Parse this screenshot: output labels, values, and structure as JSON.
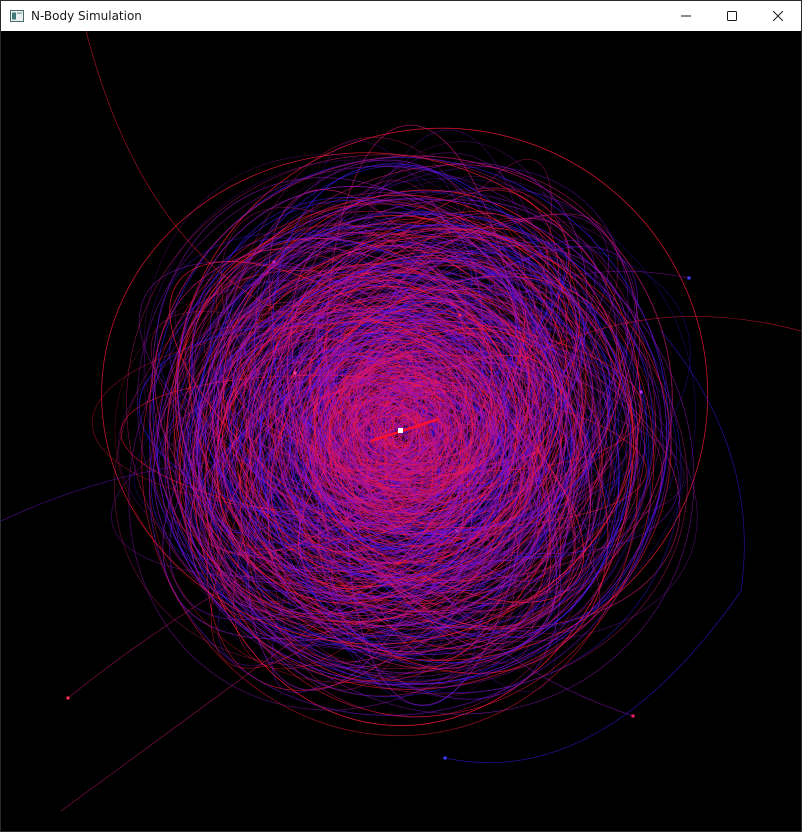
{
  "window": {
    "title": "N-Body Simulation",
    "app_icon": "window-app-icon",
    "controls": {
      "minimize_icon": "minimize-icon",
      "maximize_icon": "maximize-icon",
      "close_icon": "close-icon"
    }
  },
  "simulation": {
    "background_color": "#000000",
    "trail_colors": [
      "#ff1a3a",
      "#d4157a",
      "#9a12c8",
      "#3a1aff",
      "#7a10e0"
    ],
    "central_body_color": "#ffffff"
  }
}
